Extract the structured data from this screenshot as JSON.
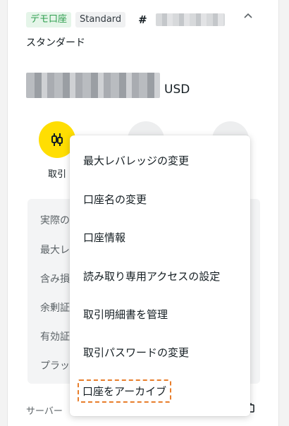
{
  "account": {
    "demo_badge": "デモ口座",
    "plan_badge": "Standard",
    "number_prefix": "#",
    "type_label": "スタンダード",
    "balance_currency": "USD"
  },
  "actions": {
    "trade_label": "取引"
  },
  "info_rows": [
    {
      "label": "実際の"
    },
    {
      "label": "最大レ"
    },
    {
      "label": "含み損"
    },
    {
      "label": "余剰証"
    },
    {
      "label": "有効証"
    },
    {
      "label": "プラット"
    }
  ],
  "footer": {
    "server_label": "サーバー"
  },
  "menu": {
    "items": [
      {
        "label": "最大レバレッジの変更"
      },
      {
        "label": "口座名の変更"
      },
      {
        "label": "口座情報"
      },
      {
        "label": "読み取り専用アクセスの設定"
      },
      {
        "label": "取引明細書を管理"
      },
      {
        "label": "取引パスワードの変更"
      },
      {
        "label": "口座をアーカイブ"
      }
    ]
  },
  "colors": {
    "accent_yellow": "#ffde02",
    "demo_green": "#2e9e4e",
    "highlight_orange": "#e87e2b"
  }
}
